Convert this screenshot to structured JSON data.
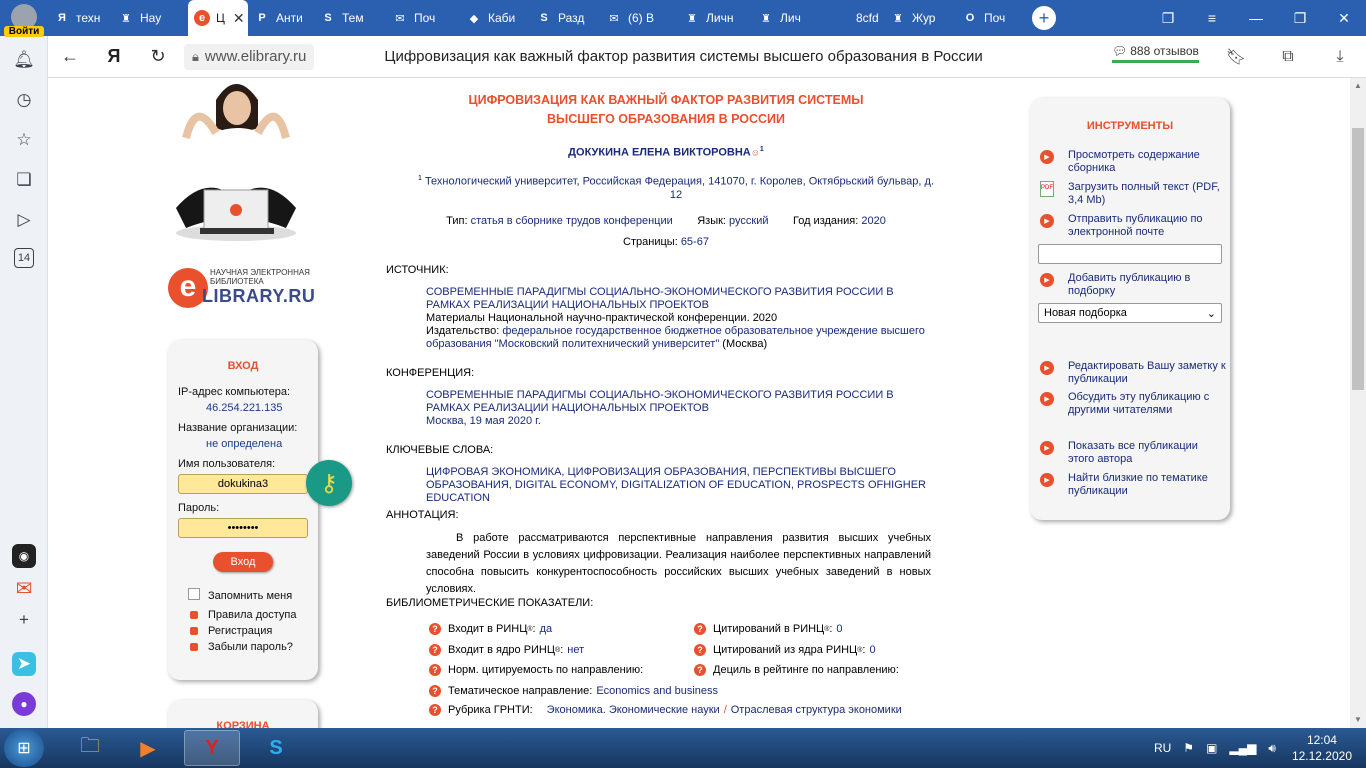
{
  "browser": {
    "tabs": [
      {
        "label": "техн",
        "icon": "Я"
      },
      {
        "label": "Нау",
        "icon": "♜"
      },
      {
        "label": "Ц",
        "icon": "e",
        "active": true
      },
      {
        "label": "Анти",
        "icon": "P"
      },
      {
        "label": "Тем",
        "icon": "S"
      },
      {
        "label": "Поч",
        "icon": "✉"
      },
      {
        "label": "Каби",
        "icon": "◆"
      },
      {
        "label": "Разд",
        "icon": "S"
      },
      {
        "label": "(6) В",
        "icon": "✉"
      },
      {
        "label": "Личн",
        "icon": "♜"
      },
      {
        "label": "Лич",
        "icon": "♜"
      },
      {
        "label": "8cfd",
        "icon": ""
      },
      {
        "label": "Жур",
        "icon": "♜"
      },
      {
        "label": "Поч",
        "icon": "O"
      }
    ],
    "url": "www.elibrary.ru",
    "page_title": "Цифровизация как важный фактор развития системы высшего образования в России",
    "reviews": "888 отзывов",
    "sidebar_login": "Войти",
    "sidebar_badge": "14"
  },
  "site": {
    "logo_small": "НАУЧНАЯ ЭЛЕКТРОННАЯ БИБЛИОТЕКА",
    "logo_big": "LIBRARY.RU",
    "logo_e": "e"
  },
  "login": {
    "title": "ВХОД",
    "ip_label": "IP-адрес компьютера:",
    "ip_value": "46.254.221.135",
    "org_label": "Название организации:",
    "org_value": "не определена",
    "user_label": "Имя пользователя:",
    "user_value": "dokukina3",
    "pass_label": "Пароль:",
    "pass_value": "••••••••",
    "button": "Вход",
    "remember": "Запомнить меня",
    "links": [
      "Правила доступа",
      "Регистрация",
      "Забыли пароль?"
    ],
    "cart_title": "КОРЗИНА"
  },
  "article": {
    "title_line1": "ЦИФРОВИЗАЦИЯ КАК ВАЖНЫЙ ФАКТОР РАЗВИТИЯ СИСТЕМЫ",
    "title_line2": "ВЫСШЕГО ОБРАЗОВАНИЯ В РОССИИ",
    "author": "ДОКУКИНА ЕЛЕНА ВИКТОРОВНА",
    "author_sup": "1",
    "aff_sup": "1",
    "affiliation": "Технологический университет, Российская Федерация, 141070, г. Королев, Октябрьский бульвар, д. 12",
    "type_label": "Тип:",
    "type_value": "статья в сборнике трудов конференции",
    "lang_label": "Язык:",
    "lang_value": "русский",
    "year_label": "Год издания:",
    "year_value": "2020",
    "pages_label": "Страницы:",
    "pages_value": "65-67",
    "source_label": "ИСТОЧНИК:",
    "source_title": "СОВРЕМЕННЫЕ ПАРАДИГМЫ СОЦИАЛЬНО-ЭКОНОМИЧЕСКОГО РАЗВИТИЯ РОССИИ В РАМКАХ РЕАЛИЗАЦИИ НАЦИОНАЛЬНЫХ ПРОЕКТОВ",
    "source_materials": "Материалы Национальной научно-практической конференции. 2020",
    "publisher_label": "Издательство:",
    "publisher_value": "федеральное государственное бюджетное образовательное учреждение высшего образования \"Московский политехнический университет\"",
    "publisher_city": "(Москва)",
    "conf_label": "КОНФЕРЕНЦИЯ:",
    "conf_title": "СОВРЕМЕННЫЕ ПАРАДИГМЫ СОЦИАЛЬНО-ЭКОНОМИЧЕСКОГО РАЗВИТИЯ РОССИИ В РАМКАХ РЕАЛИЗАЦИИ НАЦИОНАЛЬНЫХ ПРОЕКТОВ",
    "conf_place": "Москва, 19 мая 2020 г.",
    "kw_label": "КЛЮЧЕВЫЕ СЛОВА:",
    "keywords": "ЦИФРОВАЯ ЭКОНОМИКА, ЦИФРОВИЗАЦИЯ ОБРАЗОВАНИЯ, ПЕРСПЕКТИВЫ ВЫСШЕГО ОБРАЗОВАНИЯ, DIGITAL ECONOMY, DIGITALIZATION OF EDUCATION, PROSPECTS OFHIGHER EDUCATION",
    "abs_label": "АННОТАЦИЯ:",
    "abstract": "В работе рассматриваются перспективные направления развития высших учебных заведений России в условиях цифровизации. Реализация наиболее перспективных направлений способна повысить конкурентоспособность российских высших учебных заведений в новых условиях.",
    "bm_label": "БИБЛИОМЕТРИЧЕСКИЕ ПОКАЗАТЕЛИ:",
    "bm": {
      "rinc_label": "Входит в РИНЦ",
      "rinc_value": "да",
      "core_label": "Входит в ядро РИНЦ",
      "core_value": "нет",
      "norm_label": "Норм. цитируемость по направлению:",
      "cit_label": "Цитирований в РИНЦ",
      "cit_value": "0",
      "citcore_label": "Цитирований из ядра РИНЦ",
      "citcore_value": "0",
      "decile_label": "Дециль в рейтинге по направлению:",
      "topic_label": "Тематическое направление:",
      "topic_value": "Economics and business",
      "grnti_label": "Рубрика ГРНТИ:",
      "grnti_value1": "Экономика. Экономические науки",
      "grnti_sep": "/",
      "grnti_value2": "Отраслевая структура экономики",
      "reg": "®"
    }
  },
  "tools": {
    "title": "ИНСТРУМЕНТЫ",
    "items": [
      "Просмотреть содержание сборника",
      "Загрузить полный текст (PDF, 3,4 Mb)",
      "Отправить публикацию по электронной почте",
      "Добавить публикацию в подборку",
      "Редактировать Вашу заметку к публикации",
      "Обсудить эту публикацию с другими читателями",
      "Показать все публикации этого автора",
      "Найти близкие по тематике публикации"
    ],
    "collection_select": "Новая подборка",
    "pdf_icon": "PDF"
  },
  "taskbar": {
    "lang": "RU",
    "time": "12:04",
    "date": "12.12.2020"
  }
}
